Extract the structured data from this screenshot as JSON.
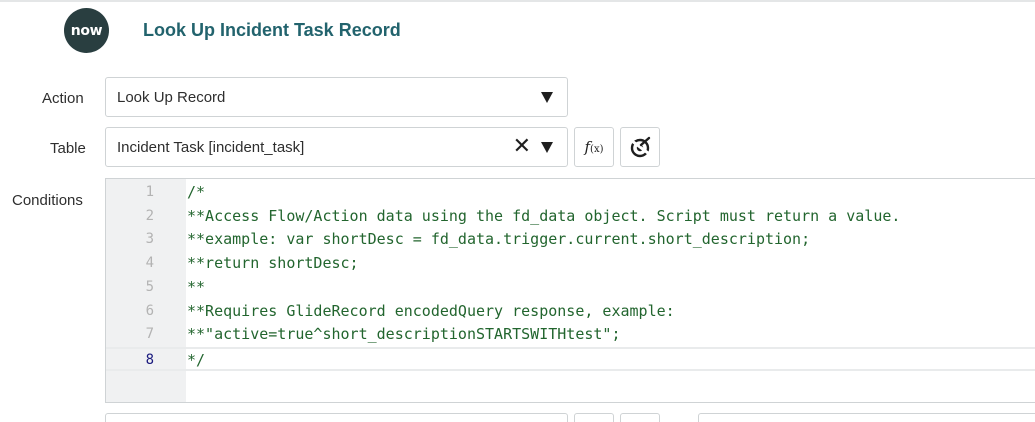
{
  "header": {
    "logo_text": "now",
    "title": "Look Up Incident Task Record"
  },
  "form": {
    "action": {
      "label": "Action",
      "value": "Look Up Record"
    },
    "table": {
      "label": "Table",
      "value": "Incident Task [incident_task]"
    },
    "conditions": {
      "label": "Conditions"
    }
  },
  "editor": {
    "lines": [
      {
        "num": "1",
        "code": "/*"
      },
      {
        "num": "2",
        "code": "**Access Flow/Action data using the fd_data object. Script must return a value."
      },
      {
        "num": "3",
        "code": "**example: var shortDesc = fd_data.trigger.current.short_description;"
      },
      {
        "num": "4",
        "code": "**return shortDesc;"
      },
      {
        "num": "5",
        "code": "**"
      },
      {
        "num": "6",
        "code": "**Requires GlideRecord encodedQuery response, example:"
      },
      {
        "num": "7",
        "code": "**\"active=true^short_descriptionSTARTSWITHtest\";"
      },
      {
        "num": "8",
        "code": "*/"
      }
    ],
    "active_line": "8"
  },
  "icons": {
    "logo": "servicenow-logo",
    "caret": "chevron-down-icon",
    "clear": "close-icon",
    "function": "fx-icon",
    "toggle": "script-toggle-icon"
  }
}
